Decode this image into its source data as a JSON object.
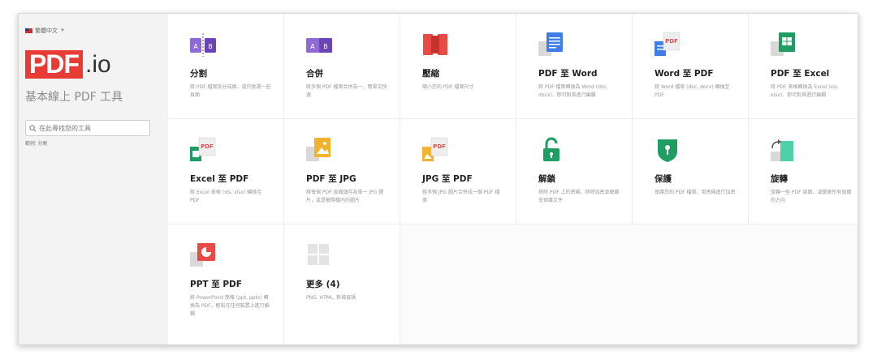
{
  "sidebar": {
    "language": "繁體中文",
    "logo_text": "PDF",
    "logo_suffix": ".io",
    "tagline": "基本線上 PDF 工具",
    "search_placeholder": "在此尋找您的工具",
    "example": "範例: 分割"
  },
  "tools": [
    {
      "title": "分割",
      "desc": "將 PDF 檔案拆分成幾，或只挑選一些頁面",
      "icon": "split-icon"
    },
    {
      "title": "合併",
      "desc": "將多個 PDF 檔案合併為一，簡單又快速",
      "icon": "merge-icon"
    },
    {
      "title": "壓縮",
      "desc": "縮小您的 PDF 檔案尺寸",
      "icon": "compress-icon"
    },
    {
      "title": "PDF 至 Word",
      "desc": "將 PDF 檔案轉換為 Word (doc, docx)，即可對其進行編輯",
      "icon": "pdf-to-word-icon"
    },
    {
      "title": "Word 至 PDF",
      "desc": "將 Word 檔案 (doc, docx) 轉換至 PDF",
      "icon": "word-to-pdf-icon"
    },
    {
      "title": "PDF 至 Excel",
      "desc": "將 PDF 表格轉換為 Excel (xls, xlsx)，即可對其進行編輯",
      "icon": "pdf-to-excel-icon"
    },
    {
      "title": "Excel 至 PDF",
      "desc": "將 Excel 表格 (xls, xlsx) 轉換至 PDF",
      "icon": "excel-to-pdf-icon"
    },
    {
      "title": "PDF 至 JPG",
      "desc": "將每個 PDF 頁面儲存為單一 JPG 圖片，或是解開檔內的圖片",
      "icon": "pdf-to-jpg-icon"
    },
    {
      "title": "JPG 至 PDF",
      "desc": "將多個 JPG 圖片合併成一個 PDF 檔案",
      "icon": "jpg-to-pdf-icon"
    },
    {
      "title": "解鎖",
      "desc": "移除 PDF 上的密碼，移除加密並解鎖受保護文件",
      "icon": "unlock-icon"
    },
    {
      "title": "保護",
      "desc": "保護您的 PDF 檔案，用密碼進行加密",
      "icon": "protect-icon"
    },
    {
      "title": "旋轉",
      "desc": "旋轉一些 PDF 頁面，或變更所有頁面的方向",
      "icon": "rotate-icon"
    },
    {
      "title": "PPT 至 PDF",
      "desc": "將 PowerPoint 簡報 (ppt, pptx) 轉換為 PDF，輕鬆在任何裝置上進行編輯",
      "icon": "ppt-to-pdf-icon"
    },
    {
      "title": "更多 (4)",
      "desc": "PNG, HTML, 新增頁碼",
      "icon": "more-icon"
    }
  ],
  "colors": {
    "brand": "#e83b36",
    "purple": "#7e57c2",
    "blue": "#3f7ee8",
    "green": "#1f9d63",
    "orange": "#f2b22e"
  }
}
